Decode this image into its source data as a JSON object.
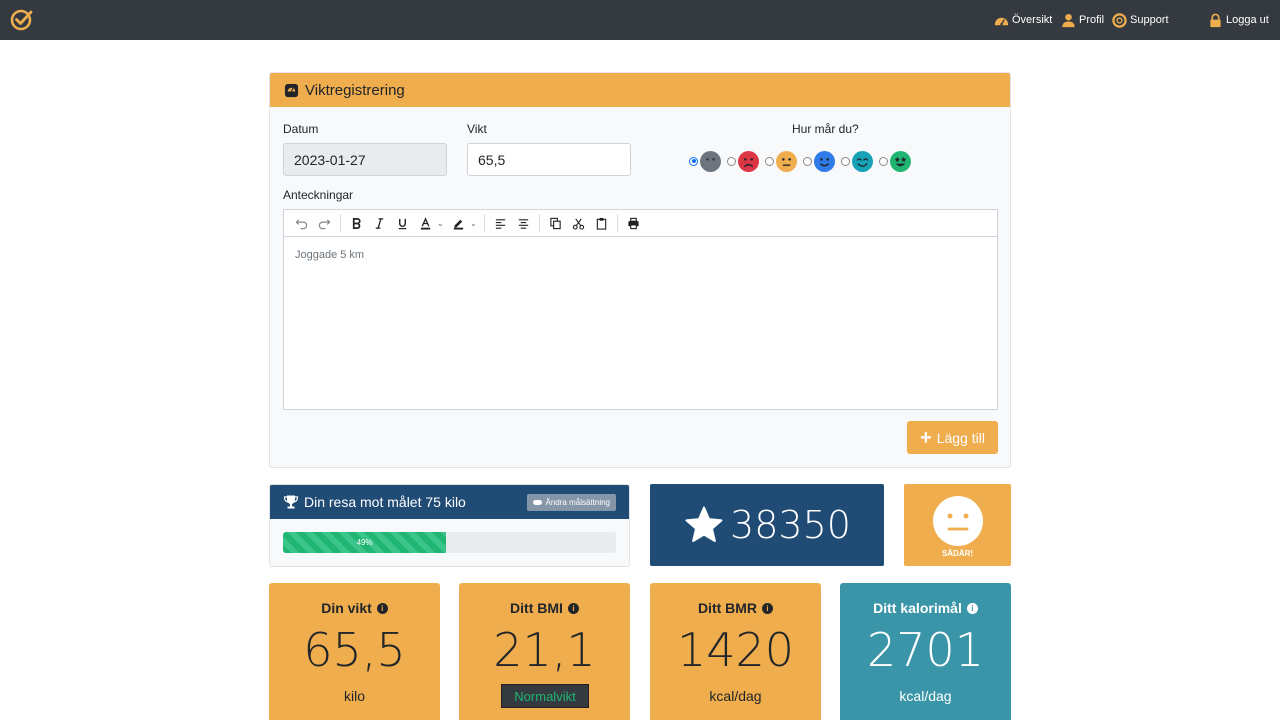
{
  "nav": {
    "items": [
      {
        "label": "Översikt",
        "icon": "dashboard-icon"
      },
      {
        "label": "Profil",
        "icon": "user-icon"
      },
      {
        "label": "Support",
        "icon": "lifebuoy-icon"
      },
      {
        "label": "Logga ut",
        "icon": "lock-icon"
      }
    ]
  },
  "weight_form": {
    "title": "Viktregistrering",
    "date_label": "Datum",
    "date_value": "2023-01-27",
    "weight_label": "Vikt",
    "weight_value": "65,5",
    "mood_label": "Hur mår du?",
    "moods": [
      {
        "icon": "neutral-face-icon",
        "color": "#6c757d",
        "checked": true
      },
      {
        "icon": "sad-face-icon",
        "color": "#dc3545",
        "checked": false
      },
      {
        "icon": "meh-face-icon",
        "color": "#efad4d",
        "checked": false
      },
      {
        "icon": "smile-face-icon",
        "color": "#2f7ce8",
        "checked": false
      },
      {
        "icon": "happy-face-icon",
        "color": "#17a2b8",
        "checked": false
      },
      {
        "icon": "grin-face-icon",
        "color": "#21b573",
        "checked": false
      }
    ],
    "notes_label": "Anteckningar",
    "notes_text": "Joggade 5 km",
    "add_label": "Lägg till"
  },
  "goal": {
    "title": "Din resa mot målet 75 kilo",
    "change_label": "Ändra målsättning",
    "progress": 49,
    "progress_label": "49%"
  },
  "points": {
    "value": "38350"
  },
  "mood_today": {
    "label": "SÅDÄR!"
  },
  "stats": {
    "weight": {
      "title": "Din vikt",
      "value": "65,5",
      "unit": "kilo"
    },
    "bmi": {
      "title": "Ditt BMI",
      "value": "21,1",
      "badge": "Normalvikt"
    },
    "bmr": {
      "title": "Ditt BMR",
      "value": "1420",
      "unit": "kcal/dag"
    },
    "calories": {
      "title": "Ditt kalorimål",
      "value": "2701",
      "unit": "kcal/dag"
    }
  },
  "colors": {
    "accent": "#efad4d",
    "navy": "#204b75",
    "teal": "#3a95a8",
    "nav_bg": "#343a40",
    "success": "#21b573"
  }
}
